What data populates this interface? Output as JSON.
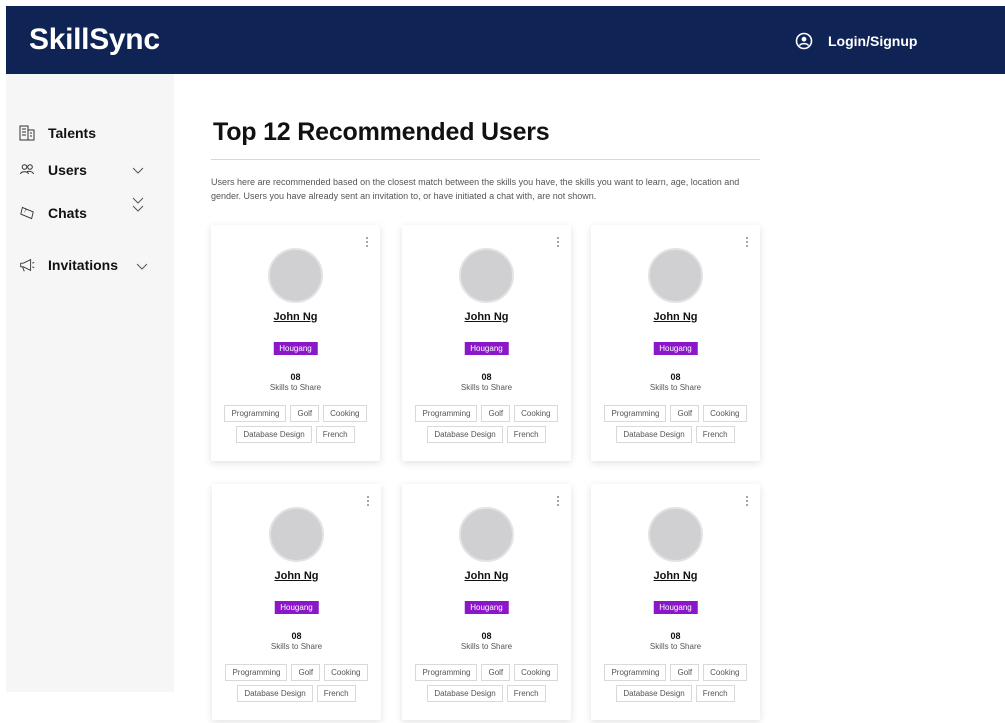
{
  "app": {
    "brand": "SkillSync",
    "login_label": "Login/Signup"
  },
  "sidebar": {
    "items": [
      {
        "label": "Talents",
        "icon": "building-icon",
        "has_chevron": false
      },
      {
        "label": "Users",
        "icon": "users-icon",
        "has_chevron": true
      },
      {
        "label": "Chats",
        "icon": "ticket-icon",
        "has_chevron": true
      },
      {
        "label": "Invitations",
        "icon": "megaphone-icon",
        "has_chevron": true
      }
    ]
  },
  "main": {
    "title": "Top 12 Recommended Users",
    "description": "Users here are recommended based on the closest match between the skills you have, the skills you want to learn, age, location and gender. Users you have already sent an invitation to, or have initiated a chat with, are not shown."
  },
  "cards": [
    {
      "name": "John Ng",
      "location": "Hougang",
      "skills_count": "08",
      "skills_label": "Skills to Share",
      "tags": [
        "Programming",
        "Golf",
        "Cooking",
        "Database Design",
        "French"
      ]
    },
    {
      "name": "John Ng",
      "location": "Hougang",
      "skills_count": "08",
      "skills_label": "Skills to Share",
      "tags": [
        "Programming",
        "Golf",
        "Cooking",
        "Database Design",
        "French"
      ]
    },
    {
      "name": "John Ng",
      "location": "Hougang",
      "skills_count": "08",
      "skills_label": "Skills to Share",
      "tags": [
        "Programming",
        "Golf",
        "Cooking",
        "Database Design",
        "French"
      ]
    },
    {
      "name": "John Ng",
      "location": "Hougang",
      "skills_count": "08",
      "skills_label": "Skills to Share",
      "tags": [
        "Programming",
        "Golf",
        "Cooking",
        "Database Design",
        "French"
      ]
    },
    {
      "name": "John Ng",
      "location": "Hougang",
      "skills_count": "08",
      "skills_label": "Skills to Share",
      "tags": [
        "Programming",
        "Golf",
        "Cooking",
        "Database Design",
        "French"
      ]
    },
    {
      "name": "John Ng",
      "location": "Hougang",
      "skills_count": "08",
      "skills_label": "Skills to Share",
      "tags": [
        "Programming",
        "Golf",
        "Cooking",
        "Database Design",
        "French"
      ]
    }
  ],
  "colors": {
    "header_bg": "#0f2355",
    "location_badge": "#8a18c9",
    "sidebar_bg": "#f6f6f6"
  }
}
